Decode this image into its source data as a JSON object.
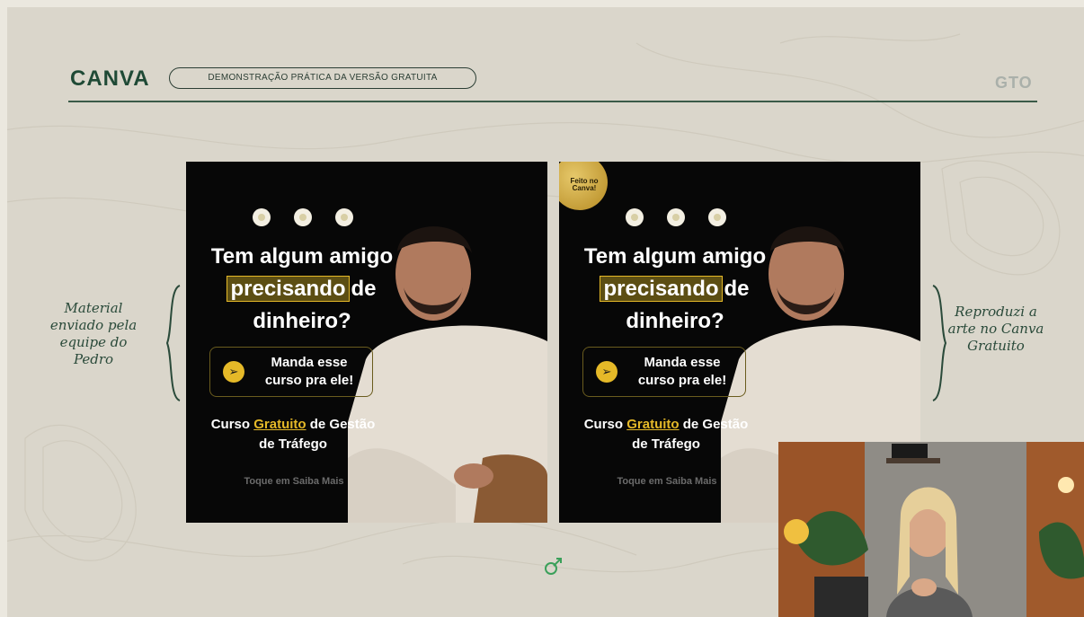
{
  "header": {
    "brand": "CANVA",
    "subtitle_pill": "DEMONSTRAÇÃO PRÁTICA DA VERSÃO GRATUITA",
    "corner_logo": "GTO"
  },
  "posts": [
    {
      "headline_line1": "Tem algum amigo",
      "headline_highlight": "precisando",
      "headline_after": "de",
      "headline_line3": "dinheiro?",
      "cta": "Manda esse curso pra ele!",
      "course_prefix": "Curso ",
      "course_accent": "Gratuito",
      "course_suffix": " de Gestão de Tráfego",
      "touch": "Toque em Saiba Mais"
    },
    {
      "badge": "Feito no Canva!",
      "headline_line1": "Tem algum amigo",
      "headline_highlight": "precisando",
      "headline_after": "de",
      "headline_line3": "dinheiro?",
      "cta": "Manda esse curso pra ele!",
      "course_prefix": "Curso ",
      "course_accent": "Gratuito",
      "course_suffix": " de Gestão de Tráfego",
      "touch": "Toque em Saiba Mais"
    }
  ],
  "notes": {
    "left": "Material enviado pela equipe do Pedro",
    "right": "Reproduzi a arte no Canva Gratuito"
  },
  "icons": {
    "cta_icon": "send-icon",
    "flower_icon": "flower-icon",
    "bottom_mark": "arrow-mark-icon"
  },
  "colors": {
    "accent_gold": "#e5b928",
    "brand_green": "#1f4a36",
    "slide_bg": "#dad6cb"
  }
}
